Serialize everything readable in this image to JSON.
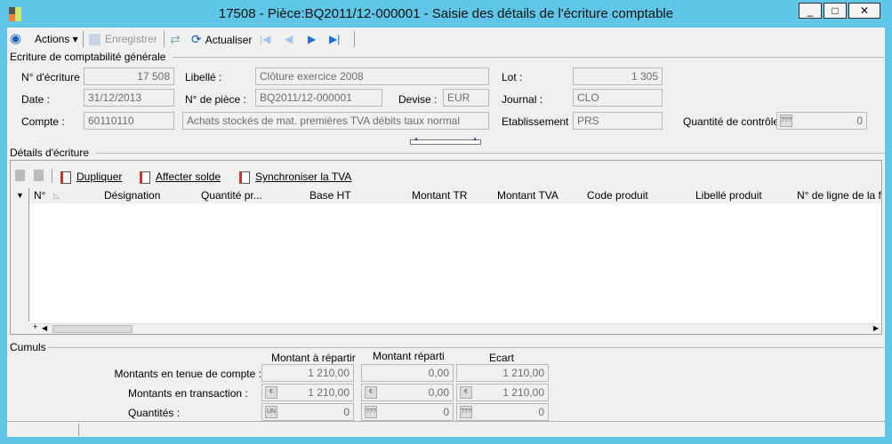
{
  "window": {
    "title": "17508 - Pièce:BQ2011/12-000001 -  Saisie des détails de l'écriture comptable",
    "controls": [
      "_",
      "□",
      "✕"
    ]
  },
  "toolbar": {
    "actions": "Actions ▾",
    "save": "Enregistrer",
    "refresh": "Actualiser"
  },
  "header": {
    "group_title": "Ecriture de comptabilité générale",
    "entry_no_label": "N° d'écriture :",
    "entry_no": "17 508",
    "label_label": "Libellé :",
    "label": "Clôture exercice 2008",
    "lot_label": "Lot :",
    "lot": "1 305",
    "date_label": "Date :",
    "date": "31/12/2013",
    "doc_no_label": "N° de pièce :",
    "doc_no": "BQ2011/12-000001",
    "currency_label": "Devise :",
    "currency": "EUR",
    "journal_label": "Journal :",
    "journal": "CLO",
    "account_label": "Compte :",
    "account": "60110110",
    "account_desc": "Achats stockés de mat. premières TVA débits taux normal",
    "establishment_label": "Etablissement :",
    "establishment": "PRS",
    "control_qty_label": "Quantité de contrôle :",
    "control_qty_unit": "???",
    "control_qty": "0"
  },
  "details": {
    "group_title": "Détails d'écriture",
    "actions": [
      "Dupliquer",
      "Affecter solde",
      "Synchroniser la TVA"
    ],
    "columns": [
      "N°",
      "Désignation",
      "Quantité pr...",
      "Base HT",
      "Montant TR",
      "Montant TVA",
      "Code produit",
      "Libellé produit",
      "N° de ligne de la f"
    ],
    "rows": []
  },
  "cumuls": {
    "group_title": "Cumuls",
    "col_headers": [
      "Montant à répartir",
      "Montant réparti",
      "Ecart"
    ],
    "rows": [
      {
        "label": "Montants en tenue de compte :",
        "units": [
          "",
          "",
          ""
        ],
        "values": [
          "1 210,00",
          "0,00",
          "1 210,00"
        ]
      },
      {
        "label": "Montants en transaction :",
        "units": [
          "€",
          "€",
          "€"
        ],
        "values": [
          "1 210,00",
          "0,00",
          "1 210,00"
        ]
      },
      {
        "label": "Quantités :",
        "units": [
          "UN",
          "???",
          "???"
        ],
        "values": [
          "0",
          "0",
          "0"
        ]
      }
    ]
  }
}
